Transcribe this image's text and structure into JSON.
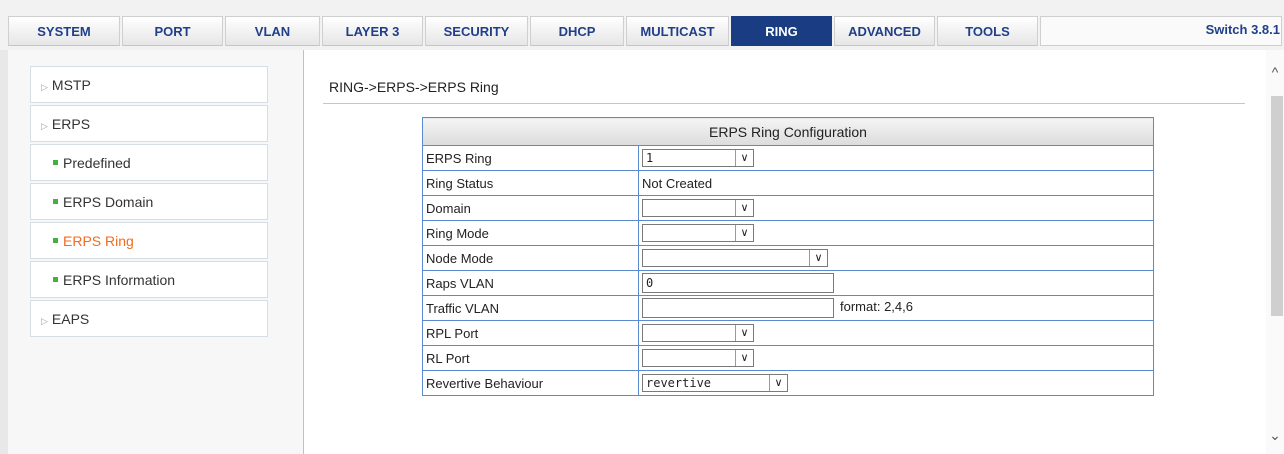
{
  "nav": {
    "tabs": [
      {
        "label": "SYSTEM",
        "active": false
      },
      {
        "label": "PORT",
        "active": false
      },
      {
        "label": "VLAN",
        "active": false
      },
      {
        "label": "LAYER 3",
        "active": false
      },
      {
        "label": "SECURITY",
        "active": false
      },
      {
        "label": "DHCP",
        "active": false
      },
      {
        "label": "MULTICAST",
        "active": false
      },
      {
        "label": "RING",
        "active": true
      },
      {
        "label": "ADVANCED",
        "active": false
      },
      {
        "label": "TOOLS",
        "active": false
      }
    ],
    "version": "Switch 3.8.1"
  },
  "sidebar": {
    "items": [
      {
        "label": "MSTP",
        "type": "group"
      },
      {
        "label": "ERPS",
        "type": "group"
      },
      {
        "label": "Predefined",
        "type": "sub"
      },
      {
        "label": "ERPS Domain",
        "type": "sub"
      },
      {
        "label": "ERPS Ring",
        "type": "sub",
        "active": true
      },
      {
        "label": "ERPS Information",
        "type": "sub"
      },
      {
        "label": "EAPS",
        "type": "group"
      }
    ]
  },
  "main": {
    "breadcrumb": "RING->ERPS->ERPS Ring",
    "table_title": "ERPS Ring Configuration",
    "rows": {
      "erps_ring": {
        "label": "ERPS Ring",
        "value": "1"
      },
      "ring_status": {
        "label": "Ring Status",
        "value": "Not Created"
      },
      "domain": {
        "label": "Domain",
        "value": ""
      },
      "ring_mode": {
        "label": "Ring Mode",
        "value": ""
      },
      "node_mode": {
        "label": "Node Mode",
        "value": ""
      },
      "raps_vlan": {
        "label": "Raps VLAN",
        "value": "0"
      },
      "traffic_vlan": {
        "label": "Traffic VLAN",
        "value": "",
        "hint": "format: 2,4,6"
      },
      "rpl_port": {
        "label": "RPL Port",
        "value": ""
      },
      "rl_port": {
        "label": "RL Port",
        "value": ""
      },
      "revertive": {
        "label": "Revertive Behaviour",
        "value": "revertive"
      }
    }
  }
}
